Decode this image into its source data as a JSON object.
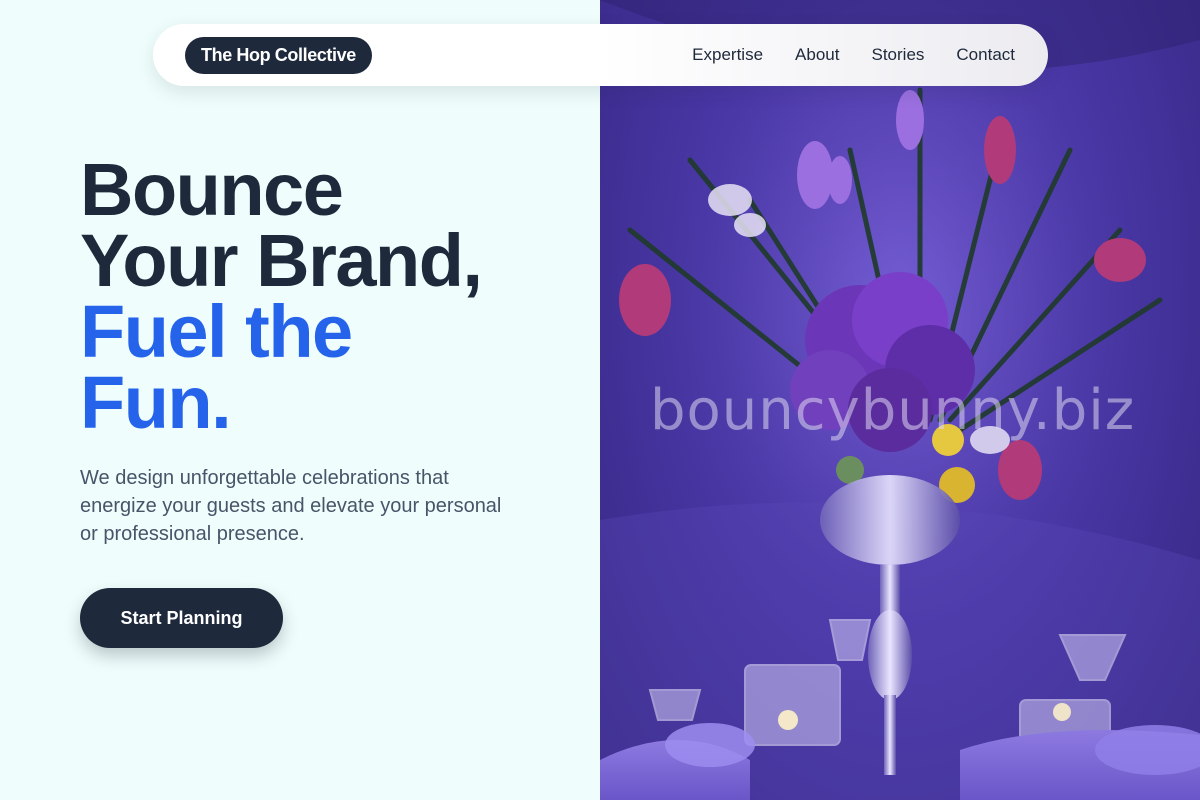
{
  "nav": {
    "brand": "The Hop Collective",
    "links": [
      "Expertise",
      "About",
      "Stories",
      "Contact"
    ]
  },
  "hero": {
    "headline_dark": [
      "Bounce",
      "Your Brand,"
    ],
    "headline_accent": [
      "Fuel the",
      "Fun."
    ],
    "subtext": "We design unforgettable celebrations that energize your guests and elevate your personal or professional presence.",
    "cta_label": "Start Planning",
    "image_watermark": "bouncybunny.biz"
  },
  "colors": {
    "dark": "#1e293b",
    "accent": "#2563eb",
    "background": "#effefc",
    "image_tone": "#4a38a8"
  }
}
